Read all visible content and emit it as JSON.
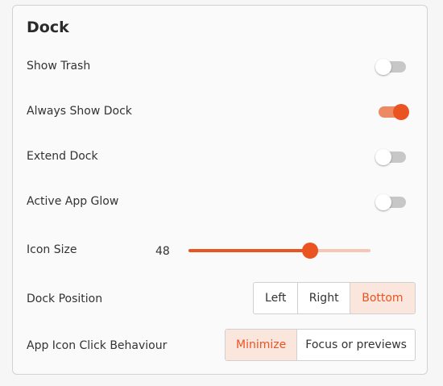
{
  "title": "Dock",
  "toggles": [
    {
      "label": "Show Trash",
      "on": false
    },
    {
      "label": "Always Show Dock",
      "on": true
    },
    {
      "label": "Extend Dock",
      "on": false
    },
    {
      "label": "Active App Glow",
      "on": false
    }
  ],
  "icon_size": {
    "label": "Icon Size",
    "value": "48",
    "fraction": 0.67
  },
  "dock_position": {
    "label": "Dock Position",
    "options": [
      "Left",
      "Right",
      "Bottom"
    ],
    "selected": "Bottom"
  },
  "click_behaviour": {
    "label": "App Icon Click Behaviour",
    "options": [
      "Minimize",
      "Focus or previews"
    ],
    "selected": "Minimize"
  },
  "colors": {
    "accent": "#e95420",
    "accent_light": "#fbe6de",
    "track_off": "#c7c7c7"
  }
}
